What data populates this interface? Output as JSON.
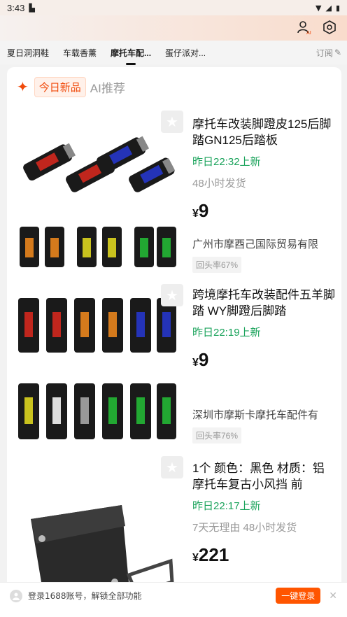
{
  "status": {
    "time": "3:43"
  },
  "tabs": [
    {
      "label": "夏日洞洞鞋"
    },
    {
      "label": "车载香薰"
    },
    {
      "label": "摩托车配..."
    },
    {
      "label": "蛋仔派对..."
    }
  ],
  "subscribe_label": "订阅",
  "section": {
    "badge": "今日新品",
    "ai_label": "AI推荐"
  },
  "products": [
    {
      "title": "摩托车改装脚蹬皮125后脚踏GN125后踏板",
      "time": "昨日22:32上新",
      "meta": "48小时发货",
      "currency": "¥",
      "price": "9",
      "company": "广州市摩酉己国际贸易有限",
      "repeat": "回头率67%"
    },
    {
      "title": "跨境摩托车改装配件五羊脚踏 WY脚蹬后脚踏",
      "time": "昨日22:19上新",
      "currency": "¥",
      "price": "9",
      "company": "深圳市摩斯卡摩托车配件有",
      "repeat": "回头率76%"
    },
    {
      "title": "1个 颜色：黑色 材质：铝 摩托车复古小风挡 前",
      "time": "昨日22:17上新",
      "meta": "7天无理由  48小时发货",
      "currency": "¥",
      "price": "221"
    }
  ],
  "login": {
    "text": "登录1688账号，解锁全部功能",
    "button": "一键登录"
  },
  "colors": {
    "accent": "#ff5500",
    "green": "#1aa35b"
  }
}
